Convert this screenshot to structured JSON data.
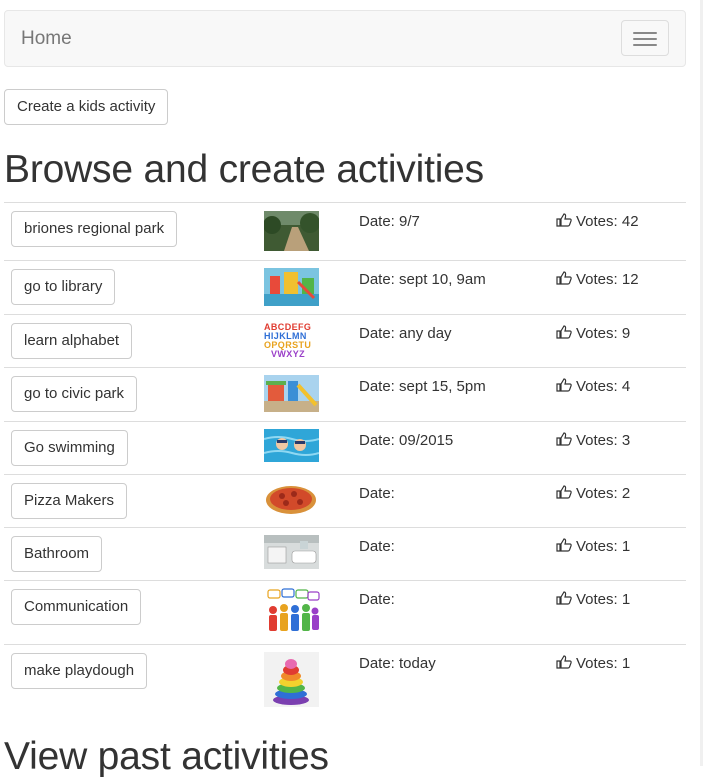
{
  "navbar": {
    "brand": "Home"
  },
  "create_button": "Create a kids activity",
  "heading": "Browse and create activities",
  "past_heading": "View past activities",
  "rows": [
    {
      "name": "briones regional park",
      "date": "Date: 9/7",
      "votes": "Votes: 42",
      "image": "trail-photo"
    },
    {
      "name": "go to library",
      "date": "Date: sept 10, 9am",
      "votes": "Votes: 12",
      "image": "playground-photo"
    },
    {
      "name": "learn alphabet",
      "date": "Date: any day",
      "votes": "Votes: 9",
      "image": "alphabet-image",
      "letters": [
        "ABCDEFG",
        "HIJKLMN",
        "OPQRSTU",
        "VWXYZ"
      ]
    },
    {
      "name": "go to civic park",
      "date": "Date: sept 15, 5pm",
      "votes": "Votes: 4",
      "image": "park-photo"
    },
    {
      "name": "Go swimming",
      "date": "Date: 09/2015",
      "votes": "Votes: 3",
      "image": "swimming-photo"
    },
    {
      "name": "Pizza Makers",
      "date": "Date:",
      "votes": "Votes: 2",
      "image": "pizza-photo"
    },
    {
      "name": "Bathroom",
      "date": "Date:",
      "votes": "Votes: 1",
      "image": "bathroom-photo"
    },
    {
      "name": "Communication",
      "date": "Date:",
      "votes": "Votes: 1",
      "image": "communication-image"
    },
    {
      "name": "make playdough",
      "date": "Date: today",
      "votes": "Votes: 1",
      "image": "playdough-photo"
    }
  ],
  "colors": {
    "text": "#333333",
    "navbar_bg": "#f8f8f8",
    "brand": "#777777",
    "border": "#dddddd"
  }
}
